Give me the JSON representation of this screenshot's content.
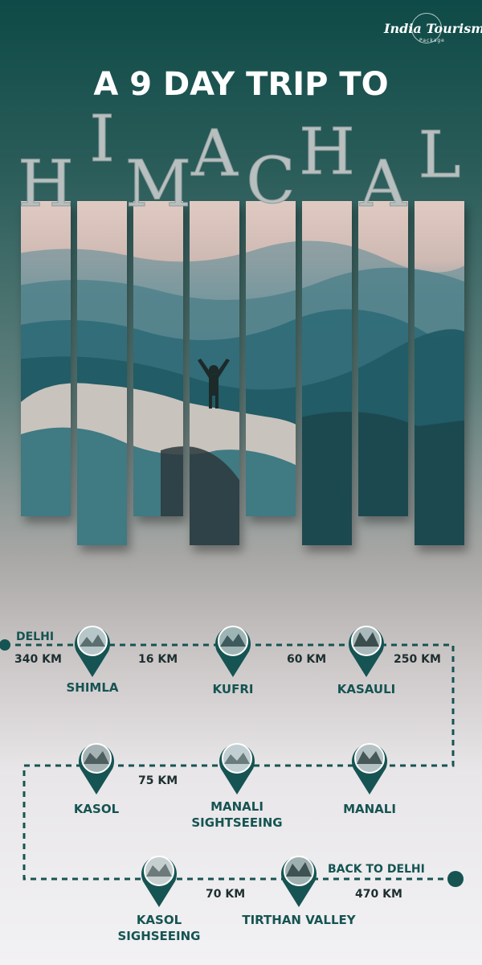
{
  "brand": {
    "name": "India Tourism",
    "sub": "Package"
  },
  "headline": "A 9 DAY TRIP TO",
  "destination": {
    "title": "HIMACHAL",
    "letters": [
      "H",
      "I",
      "M",
      "A",
      "C",
      "H",
      "A",
      "L"
    ]
  },
  "route": {
    "start": "DELHI",
    "end": "BACK TO DELHI",
    "stops": [
      {
        "name": "SHIMLA"
      },
      {
        "name": "KUFRI"
      },
      {
        "name": "KASAULI"
      },
      {
        "name": "MANALI"
      },
      {
        "name_lines": [
          "MANALI",
          "SIGHTSEEING"
        ]
      },
      {
        "name": "KASOL"
      },
      {
        "name_lines": [
          "KASOL",
          "SIGHSEEING"
        ]
      },
      {
        "name": "TIRTHAN VALLEY"
      }
    ],
    "distances": [
      "340 KM",
      "16 KM",
      "60 KM",
      "250 KM",
      "75 KM",
      "70 KM",
      "470 KM"
    ]
  },
  "colors": {
    "accent": "#155452",
    "route_line": "#155452",
    "text_dark": "#1d2f2f"
  }
}
